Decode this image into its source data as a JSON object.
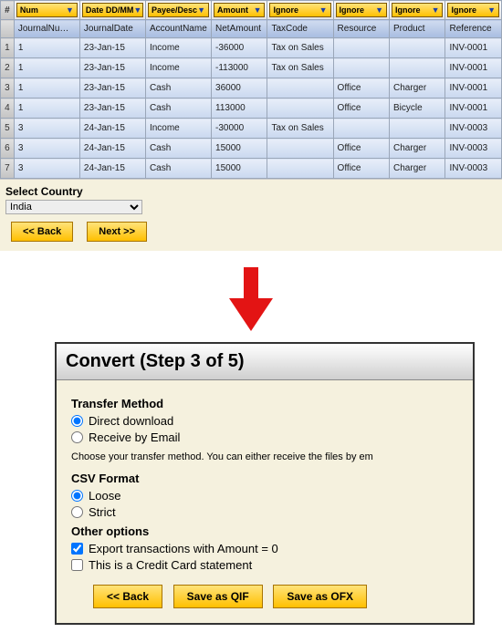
{
  "grid": {
    "hash": "#",
    "dropdowns": [
      "Num",
      "Date DD/MM",
      "Payee/Desc",
      "Amount",
      "Ignore",
      "Ignore",
      "Ignore",
      "Ignore"
    ],
    "headers": [
      "JournalNumber",
      "JournalDate",
      "AccountName",
      "NetAmount",
      "TaxCode",
      "Resource",
      "Product",
      "Reference"
    ],
    "rows": [
      {
        "n": "1",
        "c": [
          "1",
          "23-Jan-15",
          "Income",
          "-36000",
          "Tax on Sales",
          "",
          "",
          "INV-0001"
        ]
      },
      {
        "n": "2",
        "c": [
          "1",
          "23-Jan-15",
          "Income",
          "-113000",
          "Tax on Sales",
          "",
          "",
          "INV-0001"
        ]
      },
      {
        "n": "3",
        "c": [
          "1",
          "23-Jan-15",
          "Cash",
          "36000",
          "",
          "Office",
          "Charger",
          "INV-0001"
        ]
      },
      {
        "n": "4",
        "c": [
          "1",
          "23-Jan-15",
          "Cash",
          "113000",
          "",
          "Office",
          "Bicycle",
          "INV-0001"
        ]
      },
      {
        "n": "5",
        "c": [
          "3",
          "24-Jan-15",
          "Income",
          "-30000",
          "Tax on Sales",
          "",
          "",
          "INV-0003"
        ]
      },
      {
        "n": "6",
        "c": [
          "3",
          "24-Jan-15",
          "Cash",
          "15000",
          "",
          "Office",
          "Charger",
          "INV-0003"
        ]
      },
      {
        "n": "7",
        "c": [
          "3",
          "24-Jan-15",
          "Cash",
          "15000",
          "",
          "Office",
          "Charger",
          "INV-0003"
        ]
      }
    ]
  },
  "country": {
    "label": "Select Country",
    "value": "India",
    "back": "<< Back",
    "next": "Next >>"
  },
  "step3": {
    "title": "Convert (Step 3 of 5)",
    "transfer_hdr": "Transfer Method",
    "opt_direct": "Direct download",
    "opt_email": "Receive by Email",
    "desc": "Choose your transfer method. You can either receive the files by em",
    "csv_hdr": "CSV Format",
    "opt_loose": "Loose",
    "opt_strict": "Strict",
    "other_hdr": "Other options",
    "opt_zero": "Export transactions with Amount = 0",
    "opt_cc": "This is a Credit Card statement",
    "back": "<< Back",
    "qif": "Save as QIF",
    "ofx": "Save as OFX"
  }
}
